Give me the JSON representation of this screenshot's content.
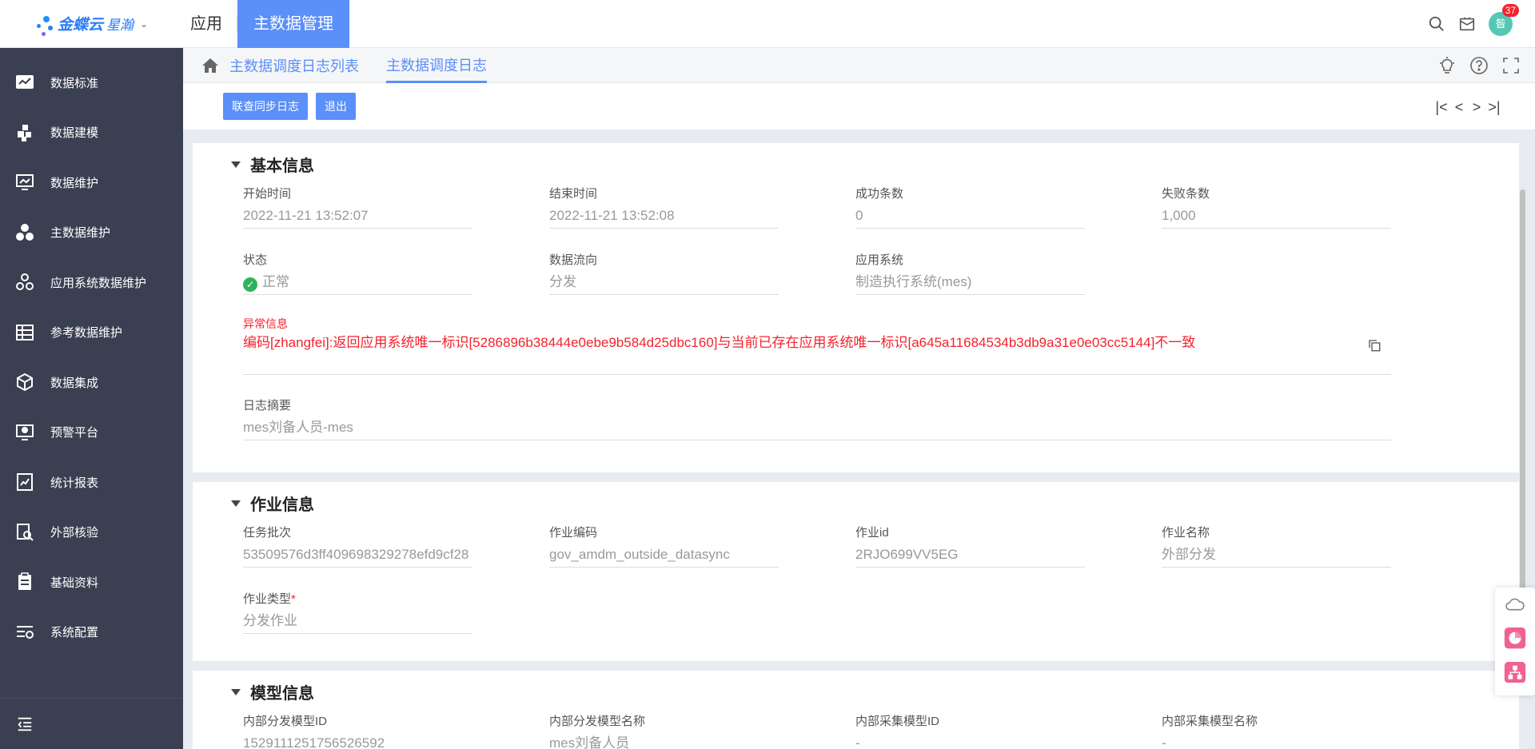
{
  "header": {
    "brand": "金蝶云",
    "brand_sub": "星瀚",
    "nav_app": "应用",
    "nav_active": "主数据管理",
    "avatar_text": "昝",
    "badge_count": "37"
  },
  "sidebar": {
    "items": [
      {
        "label": "数据标准",
        "icon": "chart-board-icon"
      },
      {
        "label": "数据建模",
        "icon": "blocks-icon"
      },
      {
        "label": "数据维护",
        "icon": "monitor-icon"
      },
      {
        "label": "主数据维护",
        "icon": "circles-icon"
      },
      {
        "label": "应用系统数据维护",
        "icon": "gear-circles-icon"
      },
      {
        "label": "参考数据维护",
        "icon": "table-icon"
      },
      {
        "label": "数据集成",
        "icon": "cube-icon"
      },
      {
        "label": "预警平台",
        "icon": "alert-screen-icon"
      },
      {
        "label": "统计报表",
        "icon": "report-icon"
      },
      {
        "label": "外部核验",
        "icon": "verify-icon"
      },
      {
        "label": "基础资料",
        "icon": "clipboard-icon"
      },
      {
        "label": "系统配置",
        "icon": "settings-list-icon"
      }
    ]
  },
  "tabs": {
    "list": "主数据调度日志列表",
    "active": "主数据调度日志"
  },
  "toolbar": {
    "btn_sync_log": "联查同步日志",
    "btn_exit": "退出"
  },
  "sections": {
    "basic": {
      "title": "基本信息",
      "start_time": {
        "label": "开始时间",
        "value": "2022-11-21 13:52:07"
      },
      "end_time": {
        "label": "结束时间",
        "value": "2022-11-21 13:52:08"
      },
      "success_count": {
        "label": "成功条数",
        "value": "0"
      },
      "fail_count": {
        "label": "失败条数",
        "value": "1,000"
      },
      "status": {
        "label": "状态",
        "value": "正常"
      },
      "flow": {
        "label": "数据流向",
        "value": "分发"
      },
      "app_system": {
        "label": "应用系统",
        "value": "制造执行系统(mes)"
      },
      "error": {
        "label": "异常信息",
        "value": "编码[zhangfei]:返回应用系统唯一标识[5286896b38444e0ebe9b584d25dbc160]与当前已存在应用系统唯一标识[a645a11684534b3db9a31e0e03cc5144]不一致"
      },
      "summary": {
        "label": "日志摘要",
        "value": "mes刘备人员-mes"
      }
    },
    "job": {
      "title": "作业信息",
      "batch": {
        "label": "任务批次",
        "value": "53509576d3ff409698329278efd9cf28"
      },
      "code": {
        "label": "作业编码",
        "value": "gov_amdm_outside_datasync"
      },
      "id": {
        "label": "作业id",
        "value": "2RJO699VV5EG"
      },
      "name": {
        "label": "作业名称",
        "value": "外部分发"
      },
      "type": {
        "label": "作业类型",
        "required_mark": "*",
        "value": "分发作业"
      }
    },
    "model": {
      "title": "模型信息",
      "dist_model_id": {
        "label": "内部分发模型ID",
        "value": "1529111251756526592"
      },
      "dist_model_name": {
        "label": "内部分发模型名称",
        "value": "mes刘备人员"
      },
      "collect_model_id": {
        "label": "内部采集模型ID",
        "value": "-"
      },
      "collect_model_name": {
        "label": "内部采集模型名称",
        "value": "-"
      }
    }
  }
}
